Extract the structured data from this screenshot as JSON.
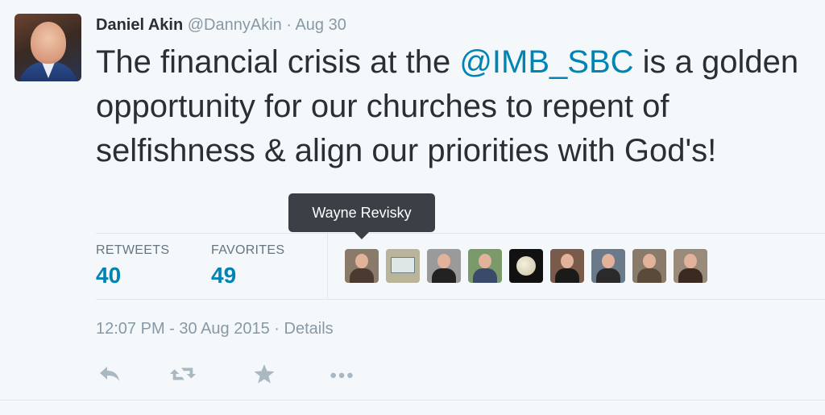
{
  "tweet": {
    "author_name": "Daniel Akin",
    "author_handle": "@DannyAkin",
    "separator": "·",
    "date": "Aug 30",
    "text_part1": "The financial crisis at the ",
    "mention": "@IMB_SBC",
    "text_part2": " is a golden opportunity for our churches to repent of selfishness & align our priorities with God's!"
  },
  "tooltip": {
    "text": "Wayne Revisky"
  },
  "stats": {
    "retweets_label": "RETWEETS",
    "retweets_value": "40",
    "favorites_label": "FAVORITES",
    "favorites_value": "49"
  },
  "favoriters": [
    {
      "name": "wayne-revisky-avatar",
      "bg": "#8a7a6a",
      "shirt": "#4a3a30"
    },
    {
      "name": "license-plate-avatar",
      "bg": "#b9b49a",
      "plate": "218"
    },
    {
      "name": "family-photo-avatar",
      "bg": "#9a9a9a",
      "shirt": "#222222"
    },
    {
      "name": "couple-avatar",
      "bg": "#7a9a6a",
      "shirt": "#3a4a6a"
    },
    {
      "name": "moon-avatar",
      "bg": "#111111"
    },
    {
      "name": "selfie-couple-avatar",
      "bg": "#7a5a4a",
      "shirt": "#1a1a1a"
    },
    {
      "name": "man-outdoors-avatar",
      "bg": "#6a7a8a",
      "shirt": "#2a2a2a"
    },
    {
      "name": "woman-blonde-avatar",
      "bg": "#8a7a6a",
      "shirt": "#5a4a3a"
    },
    {
      "name": "woman-brunette-avatar",
      "bg": "#9a8a7a",
      "shirt": "#3a2a22"
    }
  ],
  "timestamp": {
    "time": "12:07 PM - 30 Aug 2015",
    "separator": "·",
    "details_link": "Details"
  },
  "actions": [
    {
      "name": "reply-icon"
    },
    {
      "name": "retweet-icon"
    },
    {
      "name": "favorite-icon"
    },
    {
      "name": "more-icon"
    }
  ],
  "colors": {
    "background": "#f5f8fa",
    "link_blue": "#0084b4",
    "muted_gray": "#8899a6",
    "text_dark": "#292f33",
    "tooltip_bg": "#3a4046"
  }
}
